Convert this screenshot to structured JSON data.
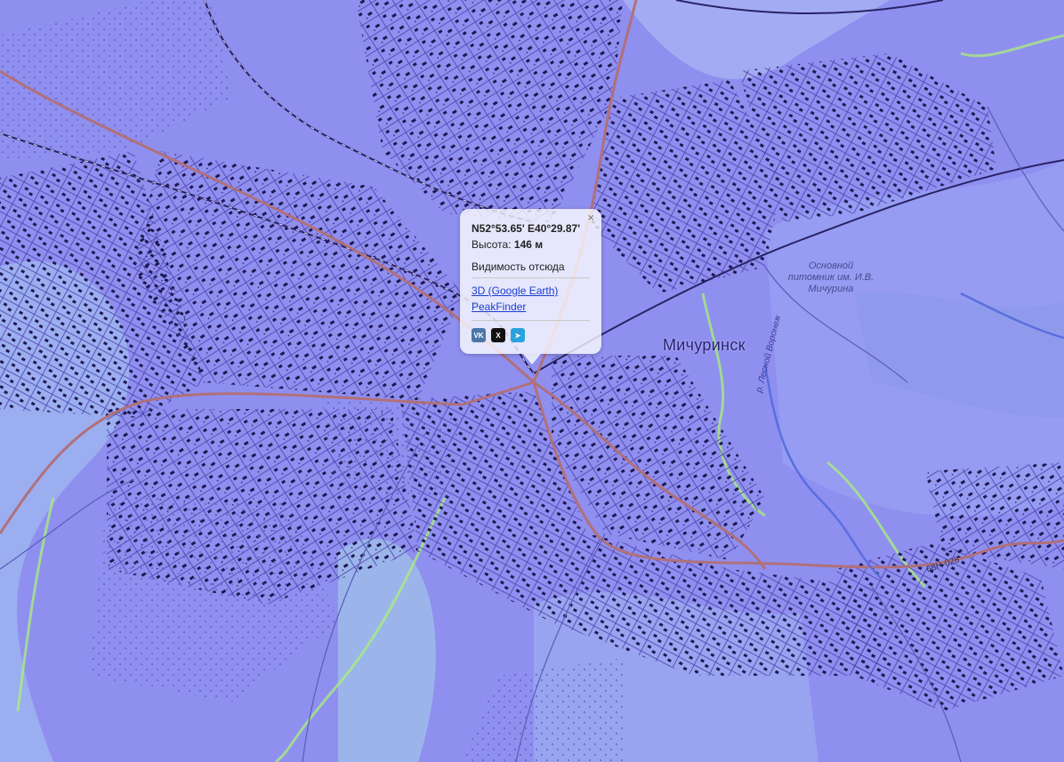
{
  "map": {
    "city_label": "Мичуринск",
    "park_label": "Основной питомник им. И.В. Мичурина",
    "river_label": "р. Лесной Воронеж",
    "road_label": "68Н-028",
    "colors": {
      "base": "#8f8ff0",
      "slope": "#9be9d8",
      "streams": "#a9f07a",
      "roads": "#b0707a",
      "buildings": "#1e1850"
    }
  },
  "popup": {
    "close_icon": "×",
    "coords": "N52°53.65' E40°29.87'",
    "altitude_label": "Высота:",
    "altitude_value": "146 м",
    "visibility_label": "Видимость отсюда",
    "link_google_earth": "3D (Google Earth)",
    "link_peakfinder": "PeakFinder",
    "share": [
      {
        "name": "vk-icon",
        "glyph": "VK"
      },
      {
        "name": "x-twitter-icon",
        "glyph": "X"
      },
      {
        "name": "telegram-icon",
        "glyph": "➤"
      }
    ]
  }
}
